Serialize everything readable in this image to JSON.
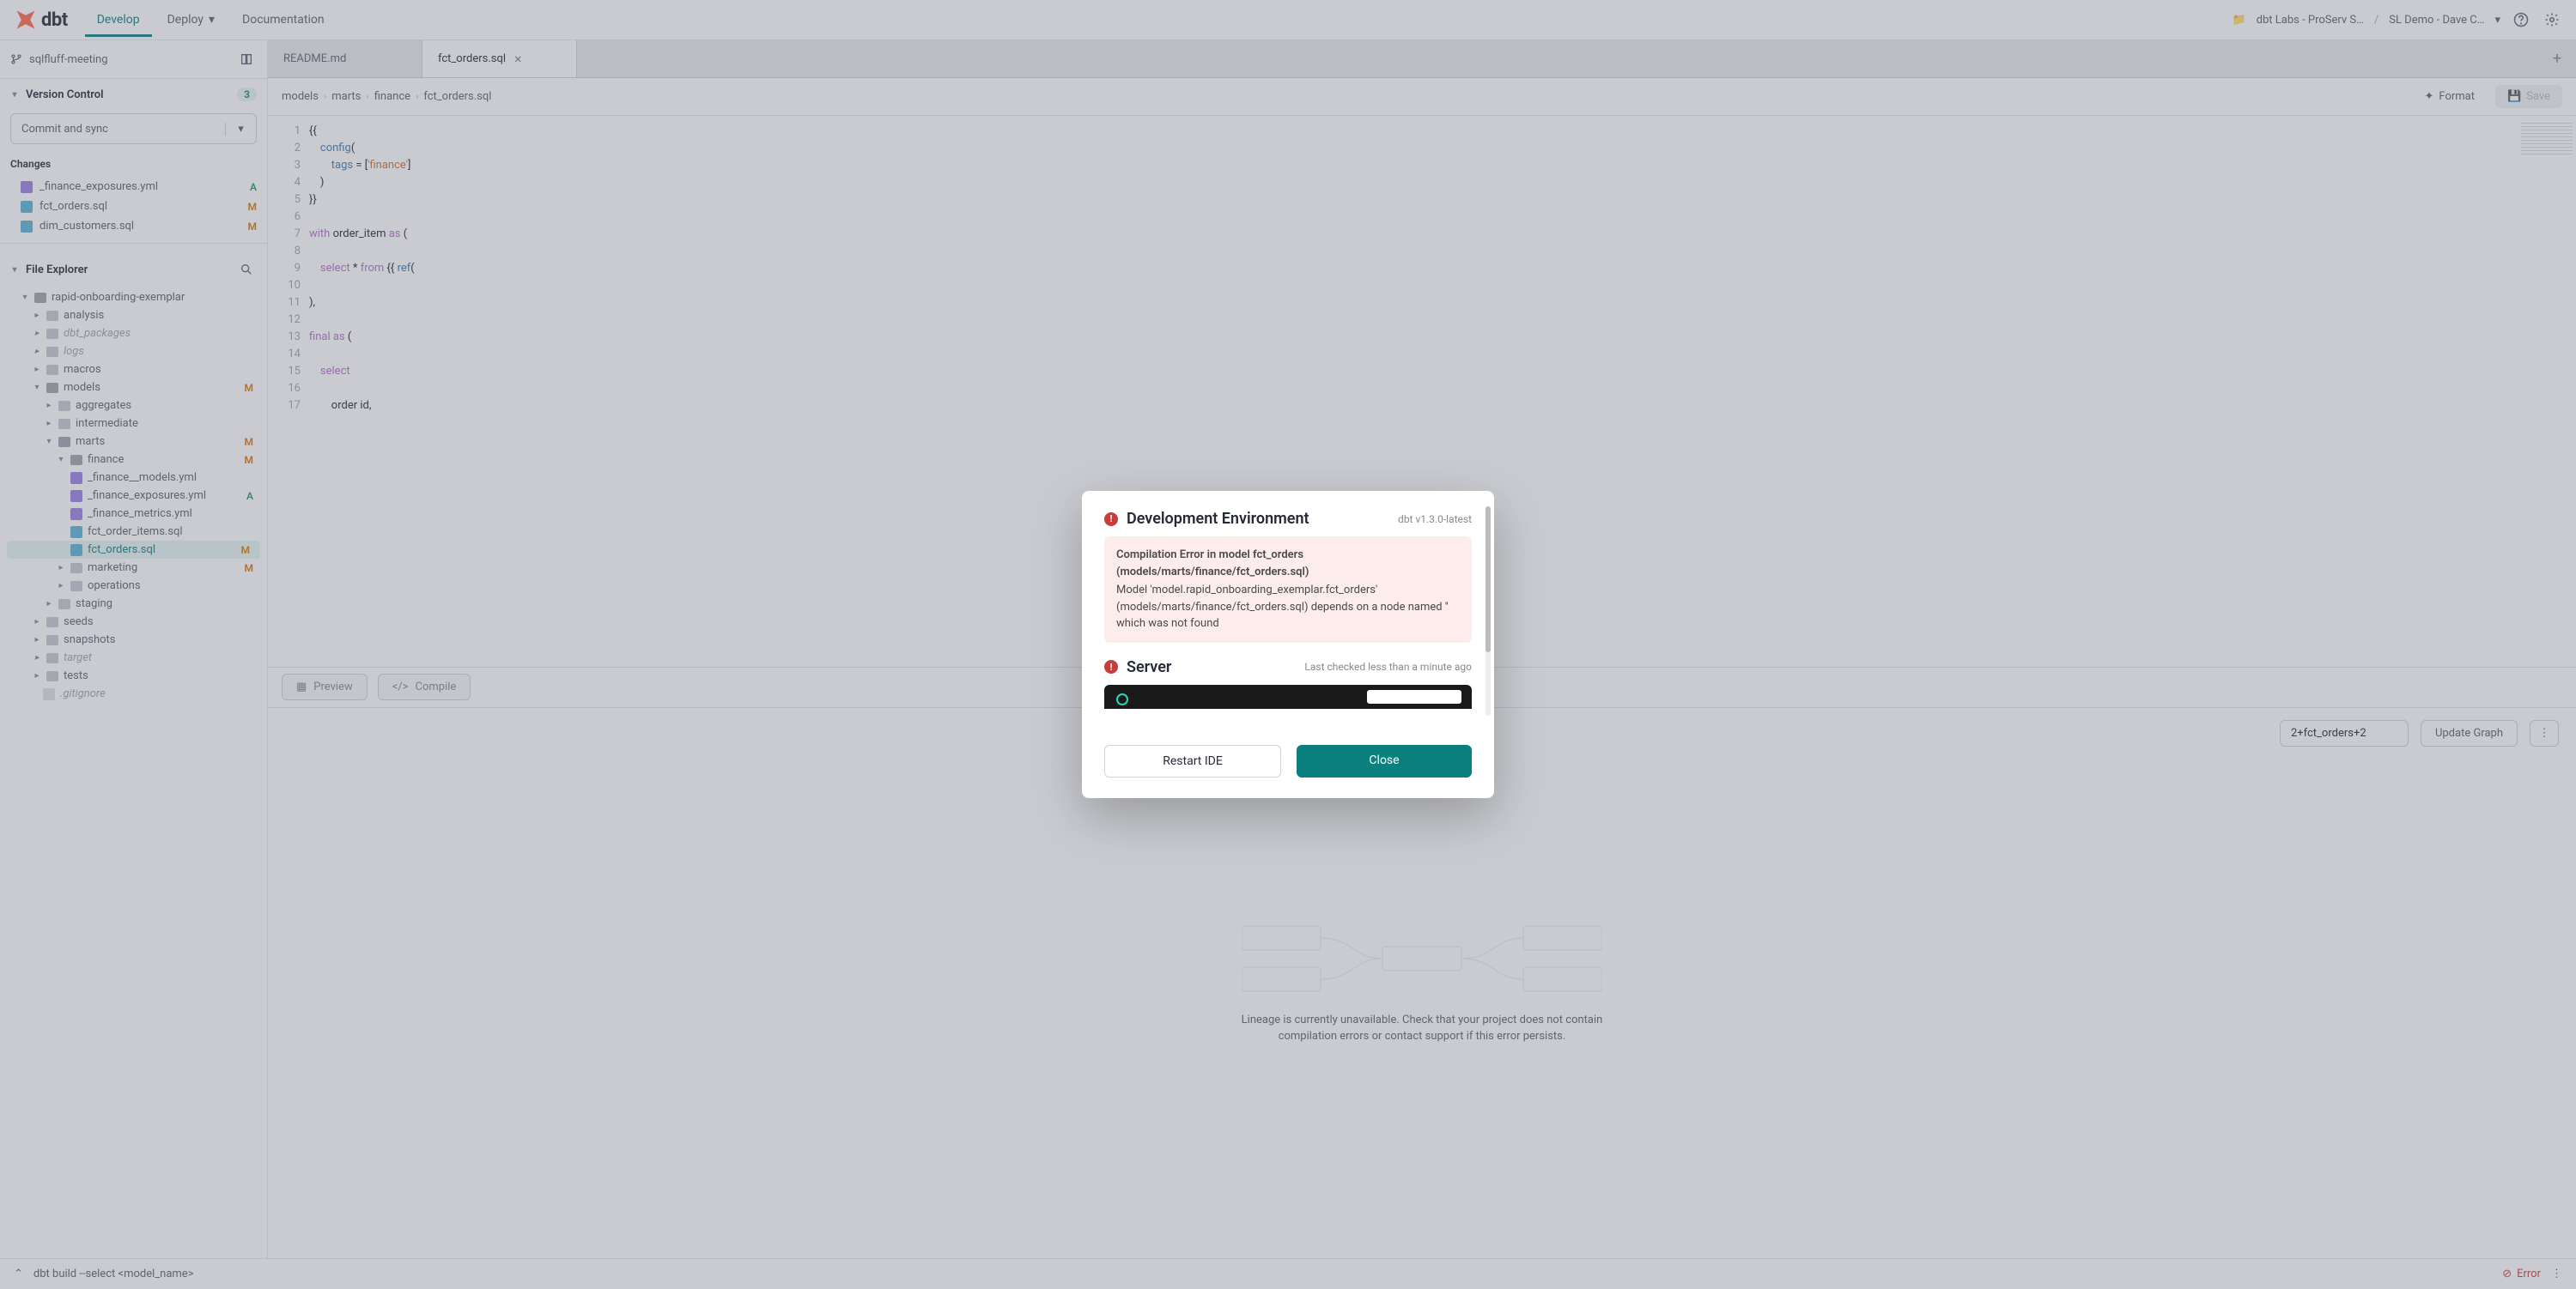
{
  "header": {
    "nav": {
      "develop": "Develop",
      "deploy": "Deploy",
      "documentation": "Documentation"
    },
    "account": "dbt Labs - ProServ S…",
    "project": "SL Demo - Dave C…"
  },
  "sidebar": {
    "branch": "sqlfluff-meeting",
    "version_control_label": "Version Control",
    "version_badge": "3",
    "commit_label": "Commit and sync",
    "changes_label": "Changes",
    "changes": [
      {
        "name": "_finance_exposures.yml",
        "status": "A",
        "type": "yml"
      },
      {
        "name": "fct_orders.sql",
        "status": "M",
        "type": "sql"
      },
      {
        "name": "dim_customers.sql",
        "status": "M",
        "type": "sql"
      }
    ],
    "file_explorer_label": "File Explorer",
    "tree": {
      "root": "rapid-onboarding-exemplar",
      "analysis": "analysis",
      "dbt_packages": "dbt_packages",
      "logs": "logs",
      "macros": "macros",
      "models": "models",
      "aggregates": "aggregates",
      "intermediate": "intermediate",
      "marts": "marts",
      "finance": "finance",
      "fin_models": "_finance__models.yml",
      "fin_exposures": "_finance_exposures.yml",
      "fin_metrics": "_finance_metrics.yml",
      "fct_order_items": "fct_order_items.sql",
      "fct_orders": "fct_orders.sql",
      "marketing": "marketing",
      "operations": "operations",
      "staging": "staging",
      "seeds": "seeds",
      "snapshots": "snapshots",
      "target": "target",
      "tests": "tests",
      "gitignore": ".gitignore"
    }
  },
  "tabs": [
    {
      "label": "README.md",
      "active": false
    },
    {
      "label": "fct_orders.sql",
      "active": true
    }
  ],
  "path": [
    "models",
    "marts",
    "finance",
    "fct_orders.sql"
  ],
  "toolbar": {
    "format": "Format",
    "save": "Save",
    "preview": "Preview",
    "compile": "Compile"
  },
  "code_lines": [
    "{{",
    "    config(",
    "        tags = ['finance']",
    "    )",
    "}}",
    "",
    "with order_item as (",
    "",
    "    select * from {{ ref(",
    "",
    "),",
    "",
    "final as (",
    "",
    "    select",
    "",
    "        order id,"
  ],
  "lineage": {
    "input": "2+fct_orders+2",
    "update": "Update Graph",
    "message": "Lineage is currently unavailable. Check that your project does not contain compilation errors or contact support if this error persists."
  },
  "footer": {
    "cmd": "dbt build --select <model_name>",
    "error": "Error"
  },
  "modal": {
    "dev_title": "Development Environment",
    "dev_version": "dbt v1.3.0-latest",
    "error_heading": "Compilation Error in model fct_orders (models/marts/finance/fct_orders.sql)",
    "error_body": "Model 'model.rapid_onboarding_exemplar.fct_orders' (models/marts/finance/fct_orders.sql) depends on a node named '' which was not found",
    "server_title": "Server",
    "server_meta": "Last checked less than a minute ago",
    "restart": "Restart IDE",
    "close": "Close"
  }
}
